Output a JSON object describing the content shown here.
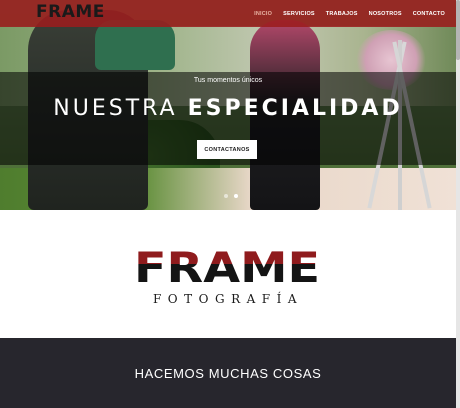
{
  "navbar": {
    "logo_text": "FRAME",
    "items": [
      {
        "label": "INICIO",
        "active": true
      },
      {
        "label": "SERVICIOS",
        "active": false
      },
      {
        "label": "TRABAJOS",
        "active": false
      },
      {
        "label": "NOSOTROS",
        "active": false
      },
      {
        "label": "CONTACTO",
        "active": false
      }
    ],
    "bg_color": "#9b1c1e"
  },
  "hero": {
    "tagline": "Tus momentos únicos",
    "headline_light": "NUESTRA",
    "headline_bold": "ESPECIALIDAD",
    "cta_label": "CONTACTANOS",
    "slides": 2,
    "active_slide": 1
  },
  "brand": {
    "logo_text": "FRAME",
    "subtitle": "FOTOGRAFÍA",
    "logo_color_top": "#8f1b1d",
    "logo_color_bottom": "#141414"
  },
  "section": {
    "title": "HACEMOS MUCHAS COSAS",
    "bg_color": "#27262d"
  }
}
